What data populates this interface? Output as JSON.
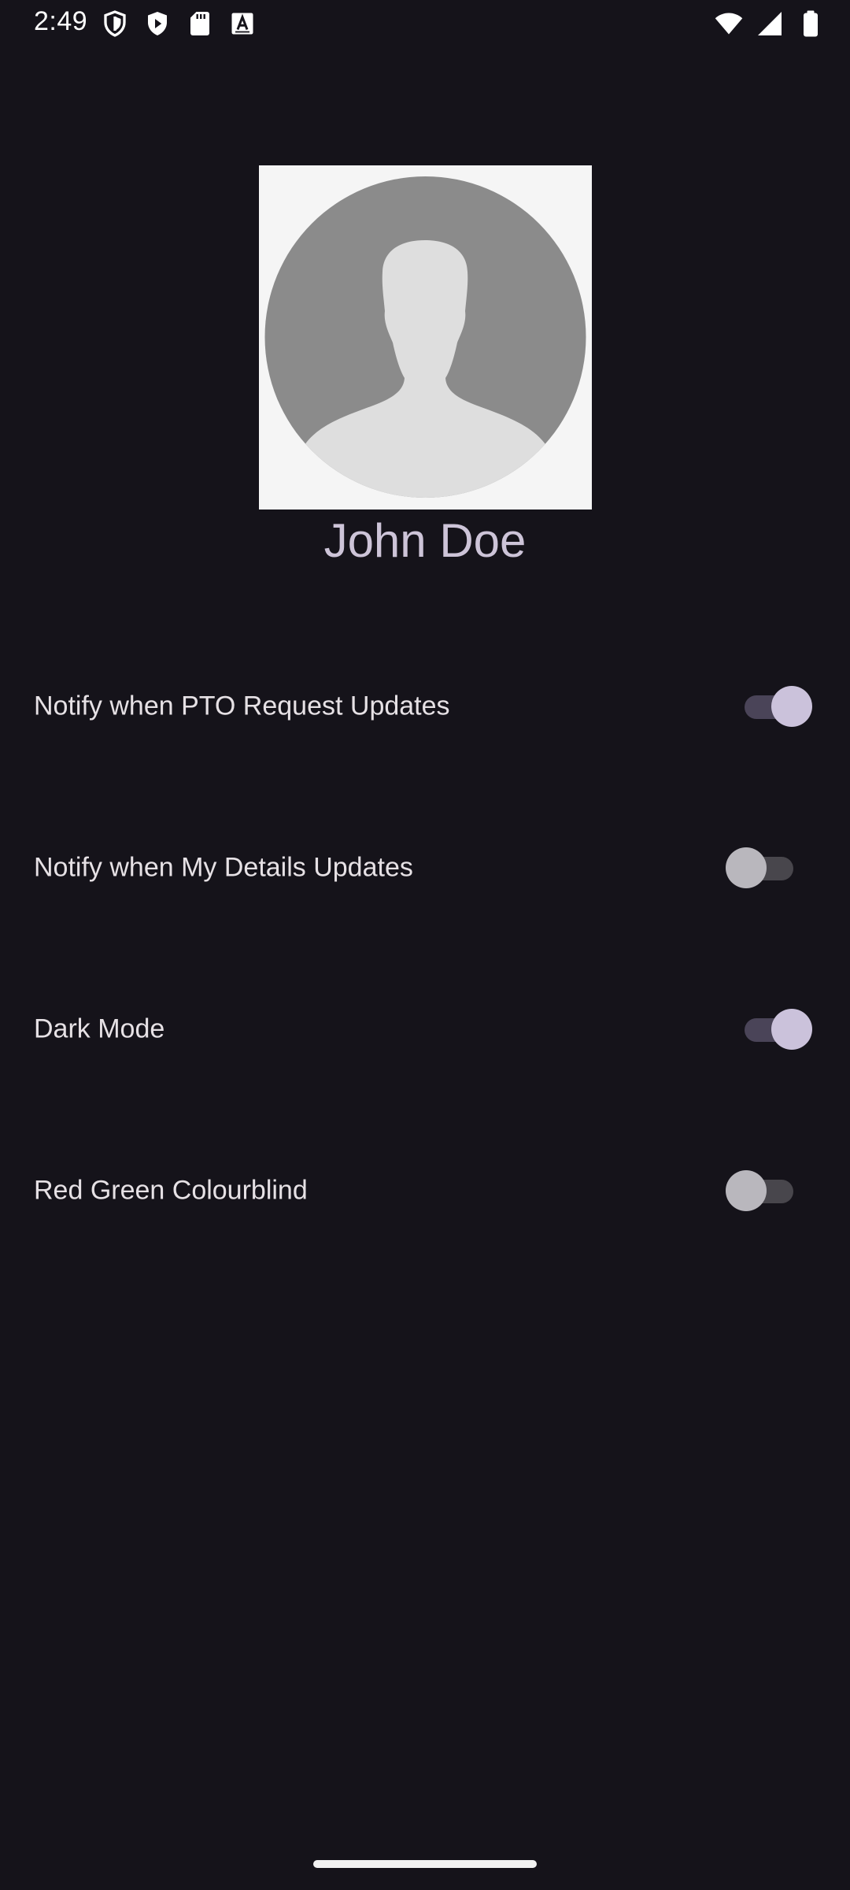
{
  "status_bar": {
    "time": "2:49",
    "left_icons": [
      "shield-icon",
      "play-protect-icon",
      "sd-card-icon",
      "keyboard-a-icon"
    ],
    "right_icons": [
      "wifi-icon",
      "cell-signal-icon",
      "battery-icon"
    ]
  },
  "profile": {
    "avatar": "default-avatar-placeholder",
    "name": "John Doe"
  },
  "settings": [
    {
      "label": "Notify when PTO Request Updates",
      "enabled": true
    },
    {
      "label": "Notify when My Details Updates",
      "enabled": false
    },
    {
      "label": "Dark Mode",
      "enabled": true
    },
    {
      "label": "Red Green Colourblind",
      "enabled": false
    }
  ],
  "colors": {
    "background": "#15131a",
    "switch_on_thumb": "#cbc2db",
    "switch_on_track": "#4a4458",
    "switch_off_thumb": "#b9b7bd",
    "switch_off_track": "#48464c",
    "name_text": "#cdc4d8"
  }
}
